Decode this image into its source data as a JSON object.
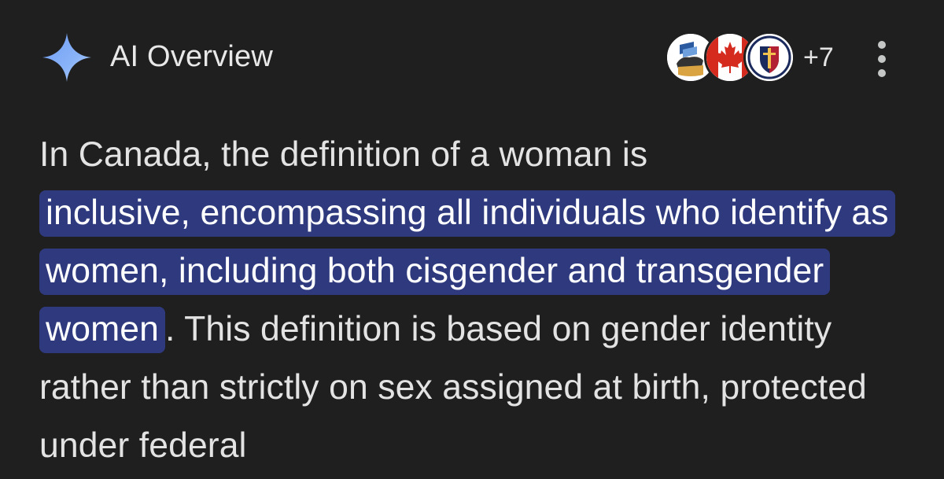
{
  "header": {
    "icon": "sparkle-icon",
    "title": "AI Overview",
    "sources": {
      "icons": [
        "university-seal-icon",
        "canada-maple-leaf-icon",
        "crest-shield-icon"
      ],
      "more_count": "+7"
    },
    "menu_icon": "more-vert-icon"
  },
  "answer": {
    "intro": "In Canada, the definition of a woman is",
    "highlight": "inclusive, encompassing all individuals who identify as women, including both cisgender and transgender women",
    "rest": ". This definition is based on gender identity rather than strictly on sex assigned at birth, protected under federal"
  },
  "colors": {
    "background": "#1f1f1f",
    "text": "#e3e3e3",
    "highlight": "#2f3a7e",
    "sparkle": "#8ab4f8",
    "canada_red": "#d52b1e"
  }
}
